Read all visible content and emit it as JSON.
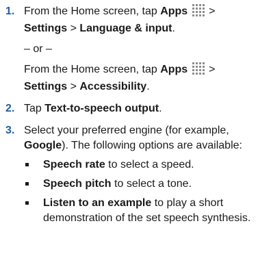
{
  "steps": [
    {
      "number": "1.",
      "line1_prefix": "From the Home screen, tap ",
      "apps": "Apps",
      "sep1": " > ",
      "settings": "Settings",
      "sep2": " > ",
      "target": "Language & input",
      "end": ".",
      "or": "– or –",
      "alt_prefix": "From the Home screen, tap ",
      "alt_apps": "Apps",
      "alt_sep1": " > ",
      "alt_settings": "Settings",
      "alt_sep2": " > ",
      "alt_target": "Accessibility",
      "alt_end": "."
    },
    {
      "number": "2.",
      "prefix": "Tap ",
      "target": "Text-to-speech output",
      "end": "."
    },
    {
      "number": "3.",
      "prefix": "Select your preferred engine (for example, ",
      "example": "Google",
      "suffix": "). The following options are available:",
      "options": [
        {
          "label": "Speech rate",
          "desc": " to select a speed."
        },
        {
          "label": "Speech pitch",
          "desc": " to select a tone."
        },
        {
          "label": "Listen to an example",
          "desc": " to play a short demonstration of the set speech synthesis."
        }
      ]
    }
  ],
  "icons": {
    "apps": "apps-grid-icon"
  },
  "colors": {
    "step_number": "#1f5fa0",
    "text": "#1a1a1a",
    "icon": "#8c8c8c"
  }
}
